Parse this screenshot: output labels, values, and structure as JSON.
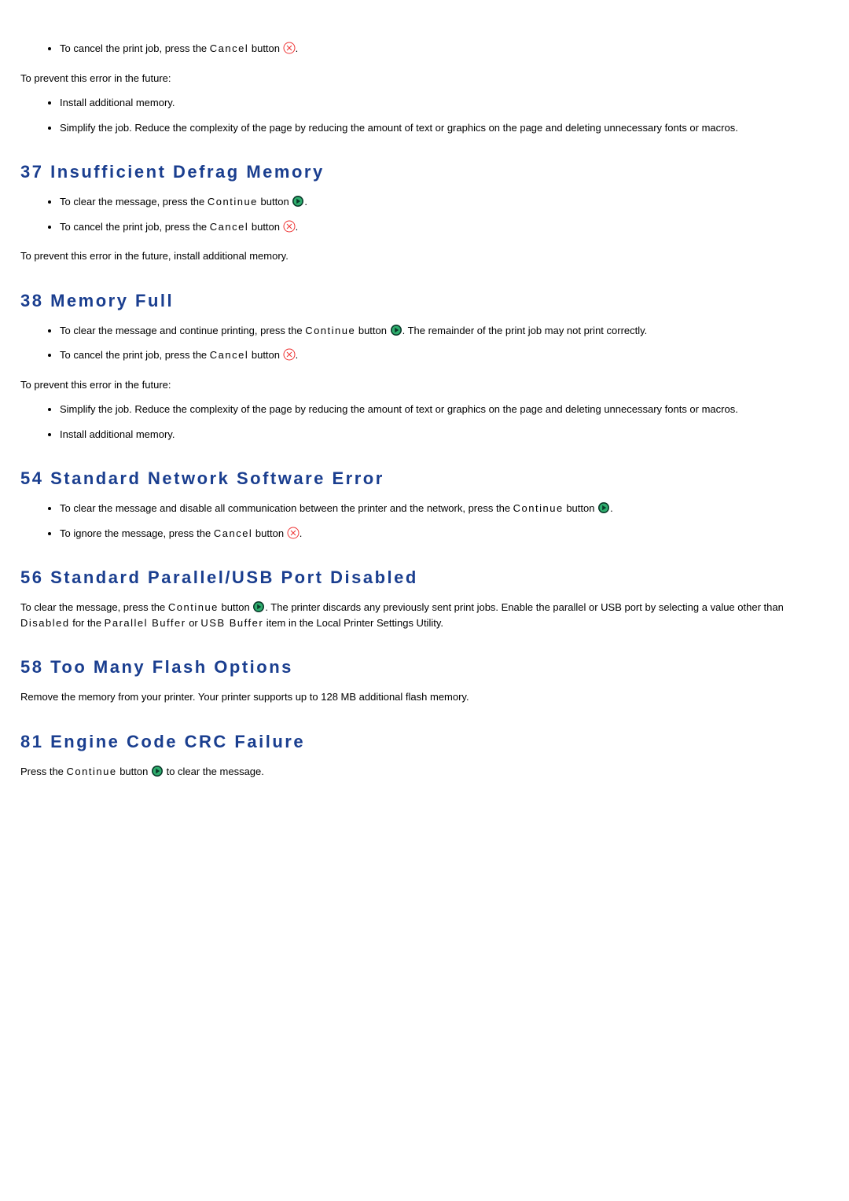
{
  "top_list": {
    "item1_pre": "To cancel the print job, press the ",
    "item1_btn": "Cancel",
    "item1_post": " button",
    "item1_end": "."
  },
  "prevent1": "To prevent this error in the future:",
  "prevent1_list": {
    "a": "Install additional memory.",
    "b": "Simplify the job. Reduce the complexity of the page by reducing the amount of text or graphics on the page and deleting unnecessary fonts or macros."
  },
  "h37": "37 Insufficient Defrag Memory",
  "s37": {
    "a_pre": "To clear the message, press the ",
    "a_btn": "Continue",
    "a_post": " button",
    "a_end": ".",
    "b_pre": "To cancel the print job, press the ",
    "b_btn": "Cancel",
    "b_post": " button",
    "b_end": "."
  },
  "s37_prevent": "To prevent this error in the future, install additional memory.",
  "h38": "38 Memory Full",
  "s38": {
    "a_pre": "To clear the message and continue printing, press the ",
    "a_btn": "Continue",
    "a_post": " button",
    "a_mid": ". The remainder of the print job may not print correctly.",
    "b_pre": "To cancel the print job, press the ",
    "b_btn": "Cancel",
    "b_post": " button",
    "b_end": "."
  },
  "s38_prevent": "To prevent this error in the future:",
  "s38_list": {
    "a": "Simplify the job. Reduce the complexity of the page by reducing the amount of text or graphics on the page and deleting unnecessary fonts or macros.",
    "b": "Install additional memory."
  },
  "h54": "54 Standard Network Software Error",
  "s54": {
    "a_pre": "To clear the message and disable all communication between the printer and the network, press the ",
    "a_btn": "Continue",
    "a_post": " button",
    "a_end": ".",
    "b_pre": "To ignore the message, press the ",
    "b_btn": "Cancel",
    "b_post": " button",
    "b_end": "."
  },
  "h56": "56 Standard Parallel/USB Port Disabled",
  "s56": {
    "p_pre": "To clear the message, press the ",
    "p_btn": "Continue",
    "p_post": " button",
    "p_mid": ". The printer discards any previously sent print jobs. Enable the parallel or USB port by selecting a value other than ",
    "p_disabled": "Disabled",
    "p_for": " for the ",
    "p_pb": "Parallel Buffer",
    "p_or": " or ",
    "p_ub": "USB Buffer",
    "p_end": " item in the Local Printer Settings Utility."
  },
  "h58": "58 Too Many Flash Options",
  "s58_p": "Remove the memory from your printer. Your printer supports up to 128 MB additional flash memory.",
  "h81": "81 Engine Code CRC Failure",
  "s81": {
    "pre": "Press the ",
    "btn": "Continue",
    "post": " button",
    "end": " to clear the message."
  }
}
